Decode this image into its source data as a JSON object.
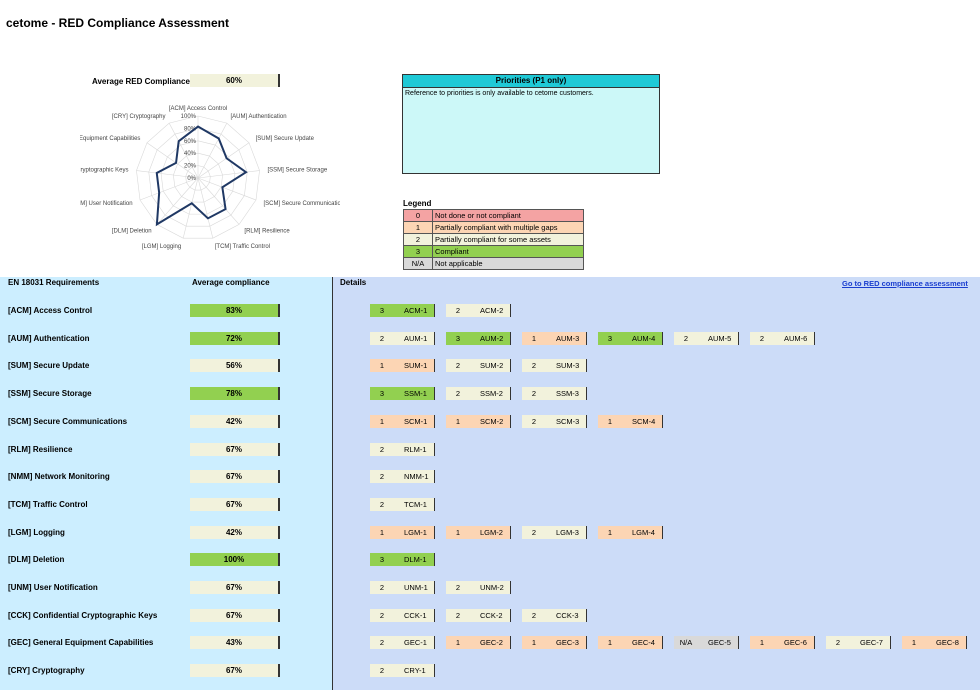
{
  "title": "cetome - RED Compliance Assessment",
  "average": {
    "label": "Average RED Compliance",
    "value": "60%"
  },
  "radar": {
    "axes": [
      "[ACM] Access Control",
      "[AUM] Authentication",
      "[SUM] Secure Update",
      "[SSM] Secure Storage",
      "[SCM] Secure Communications",
      "[RLM] Resilience",
      "[TCM] Traffic Control",
      "[LGM] Logging",
      "[DLM] Deletion",
      "[UNM] User Notification",
      "[CCK] Confidential Cryptographic Keys",
      "[GEC] General Equipment Capabilities",
      "[CRY] Cryptography"
    ],
    "ticks": [
      "100%",
      "80%",
      "60%",
      "40%",
      "20%",
      "0%"
    ],
    "values": [
      83,
      72,
      56,
      78,
      42,
      67,
      67,
      42,
      100,
      67,
      67,
      43,
      67
    ]
  },
  "priorities": {
    "title": "Priorities (P1 only)",
    "text": "Reference to priorities is only available to cetome customers."
  },
  "legend": {
    "title": "Legend",
    "items": [
      {
        "key": "0",
        "label": "Not done or not compliant",
        "color": "#f4a3a3"
      },
      {
        "key": "1",
        "label": "Partially compliant with multiple gaps",
        "color": "#fcd5b4"
      },
      {
        "key": "2",
        "label": "Partially compliant for some assets",
        "color": "#f2f2dc"
      },
      {
        "key": "3",
        "label": "Compliant",
        "color": "#92d050"
      },
      {
        "key": "N/A",
        "label": "Not applicable",
        "color": "#d9d9d9"
      }
    ]
  },
  "headers": {
    "requirements": "EN 18031 Requirements",
    "average": "Average compliance",
    "details": "Details",
    "link": "Go to RED compliance assessment"
  },
  "colors": {
    "0": "#f4a3a3",
    "1": "#fcd5b4",
    "2": "#f2f2dc",
    "3": "#92d050",
    "N/A": "#d9d9d9"
  },
  "requirements": [
    {
      "name": "[ACM] Access Control",
      "pct": "83%",
      "green": true,
      "items": [
        [
          "3",
          "ACM-1"
        ],
        [
          "2",
          "ACM-2"
        ]
      ]
    },
    {
      "name": "[AUM] Authentication",
      "pct": "72%",
      "green": true,
      "items": [
        [
          "2",
          "AUM-1"
        ],
        [
          "3",
          "AUM-2"
        ],
        [
          "1",
          "AUM-3"
        ],
        [
          "3",
          "AUM-4"
        ],
        [
          "2",
          "AUM-5"
        ],
        [
          "2",
          "AUM-6"
        ]
      ]
    },
    {
      "name": "[SUM] Secure Update",
      "pct": "56%",
      "green": false,
      "items": [
        [
          "1",
          "SUM-1"
        ],
        [
          "2",
          "SUM-2"
        ],
        [
          "2",
          "SUM-3"
        ]
      ]
    },
    {
      "name": "[SSM] Secure Storage",
      "pct": "78%",
      "green": true,
      "items": [
        [
          "3",
          "SSM-1"
        ],
        [
          "2",
          "SSM-2"
        ],
        [
          "2",
          "SSM-3"
        ]
      ]
    },
    {
      "name": "[SCM] Secure Communications",
      "pct": "42%",
      "green": false,
      "items": [
        [
          "1",
          "SCM-1"
        ],
        [
          "1",
          "SCM-2"
        ],
        [
          "2",
          "SCM-3"
        ],
        [
          "1",
          "SCM-4"
        ]
      ]
    },
    {
      "name": "[RLM] Resilience",
      "pct": "67%",
      "green": false,
      "items": [
        [
          "2",
          "RLM-1"
        ]
      ]
    },
    {
      "name": "[NMM] Network Monitoring",
      "pct": "67%",
      "green": false,
      "items": [
        [
          "2",
          "NMM-1"
        ]
      ]
    },
    {
      "name": "[TCM] Traffic Control",
      "pct": "67%",
      "green": false,
      "items": [
        [
          "2",
          "TCM-1"
        ]
      ]
    },
    {
      "name": "[LGM] Logging",
      "pct": "42%",
      "green": false,
      "items": [
        [
          "1",
          "LGM-1"
        ],
        [
          "1",
          "LGM-2"
        ],
        [
          "2",
          "LGM-3"
        ],
        [
          "1",
          "LGM-4"
        ]
      ]
    },
    {
      "name": "[DLM] Deletion",
      "pct": "100%",
      "green": true,
      "items": [
        [
          "3",
          "DLM-1"
        ]
      ]
    },
    {
      "name": "[UNM] User Notification",
      "pct": "67%",
      "green": false,
      "items": [
        [
          "2",
          "UNM-1"
        ],
        [
          "2",
          "UNM-2"
        ]
      ]
    },
    {
      "name": "[CCK] Confidential Cryptographic Keys",
      "pct": "67%",
      "green": false,
      "items": [
        [
          "2",
          "CCK-1"
        ],
        [
          "2",
          "CCK-2"
        ],
        [
          "2",
          "CCK-3"
        ]
      ]
    },
    {
      "name": "[GEC] General Equipment Capabilities",
      "pct": "43%",
      "green": false,
      "items": [
        [
          "2",
          "GEC-1"
        ],
        [
          "1",
          "GEC-2"
        ],
        [
          "1",
          "GEC-3"
        ],
        [
          "1",
          "GEC-4"
        ],
        [
          "N/A",
          "GEC-5"
        ],
        [
          "1",
          "GEC-6"
        ],
        [
          "2",
          "GEC-7"
        ],
        [
          "1",
          "GEC-8"
        ]
      ]
    },
    {
      "name": "[CRY] Cryptography",
      "pct": "67%",
      "green": false,
      "items": [
        [
          "2",
          "CRY-1"
        ]
      ]
    }
  ]
}
